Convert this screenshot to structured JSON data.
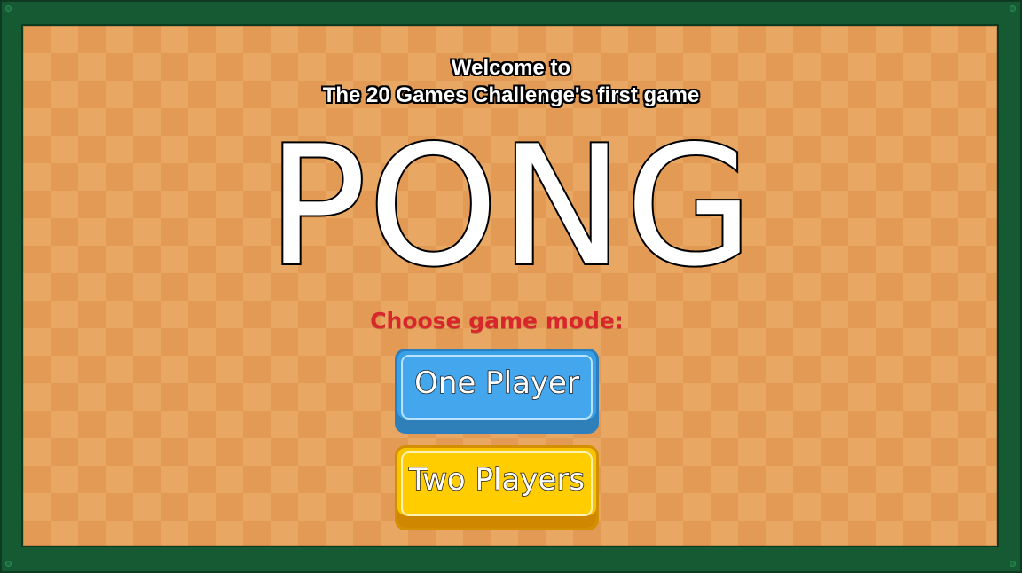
{
  "welcome": {
    "line1": "Welcome to",
    "line2": "The 20 Games Challenge's first game"
  },
  "title": "PONG",
  "menu": {
    "prompt": "Choose game mode:",
    "one_player_label": "One Player",
    "two_players_label": "Two Players"
  },
  "colors": {
    "frame": "#165a34",
    "board_light": "#e8a762",
    "board_dark": "#e39a55",
    "prompt_text": "#d8262c",
    "one_player_button": "#3aa0e6",
    "two_players_button": "#f7c400"
  }
}
